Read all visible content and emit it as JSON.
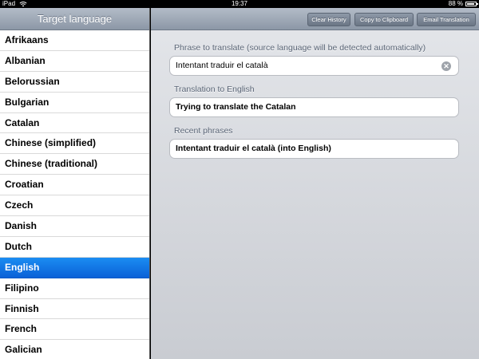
{
  "status_bar": {
    "device": "iPad",
    "time": "19:37",
    "battery": "88 %",
    "battery_level": 0.88
  },
  "language_list": {
    "title": "Target language",
    "items": [
      "Afrikaans",
      "Albanian",
      "Belorussian",
      "Bulgarian",
      "Catalan",
      "Chinese (simplified)",
      "Chinese (traditional)",
      "Croatian",
      "Czech",
      "Danish",
      "Dutch",
      "English",
      "Filipino",
      "Finnish",
      "French",
      "Galician"
    ],
    "selected": "English"
  },
  "toolbar": {
    "clear_history": "Clear History",
    "copy_clipboard": "Copy to Clipboard",
    "email_translation": "Email Translation"
  },
  "main": {
    "phrase_label": "Phrase to translate (source language will be detected automatically)",
    "phrase_value": "Intentant traduir el català",
    "translation_label": "Translation to English",
    "translation_value": "Trying to translate the Catalan",
    "recent_label": "Recent phrases",
    "recent_items": [
      "Intentant traduir el català (into English)"
    ]
  },
  "colors": {
    "selected_row": "#0a61d7",
    "header_gradient_top": "#b3bcc8",
    "header_gradient_bottom": "#8c97a6"
  }
}
